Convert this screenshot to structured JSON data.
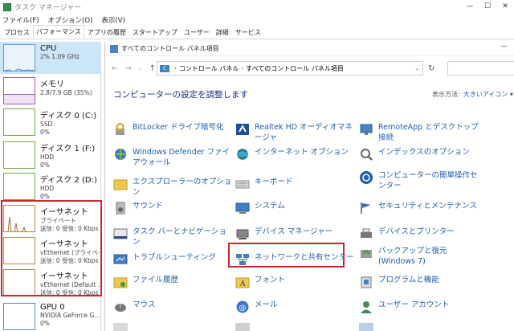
{
  "taskmgr": {
    "title": "タスク マネージャー",
    "menu": [
      "ファイル(F)",
      "オプション(O)",
      "表示(V)"
    ],
    "tabs": [
      "プロセス",
      "パフォーマンス",
      "アプリの履歴",
      "スタートアップ",
      "ユーザー",
      "詳細",
      "サービス"
    ],
    "active_tab": "パフォーマンス",
    "perf_items": [
      {
        "name": "CPU",
        "l2": "2% 1.09 GHz",
        "l3": ""
      },
      {
        "name": "メモリ",
        "l2": "2.8/7.9 GB (35%)",
        "l3": ""
      },
      {
        "name": "ディスク 0 (C:)",
        "l2": "SSD",
        "l3": "0%"
      },
      {
        "name": "ディスク 1 (F:)",
        "l2": "HDD",
        "l3": "0%"
      },
      {
        "name": "ディスク 2 (D:)",
        "l2": "HDD",
        "l3": "0%"
      },
      {
        "name": "イーサネット",
        "l2": "プライベート",
        "l3": "送信: 0 受信: 0 Kbps"
      },
      {
        "name": "イーサネット",
        "l2": "vEthernet (プライベー...",
        "l3": "送信: 0 受信: 0 Kbps"
      },
      {
        "name": "イーサネット",
        "l2": "vEthernet (Default ...",
        "l3": "送信: 0 受信: 0 Kbps"
      },
      {
        "name": "GPU 0",
        "l2": "NVIDIA GeForce G...",
        "l3": "0%"
      }
    ]
  },
  "controlpanel": {
    "window_title": "すべてのコントロール パネル項目",
    "breadcrumb": [
      "コントロール パネル",
      "すべてのコントロール パネル項目"
    ],
    "heading": "コンピューターの設定を調整します",
    "view_label": "表示方法:",
    "view_value": "大きいアイコン ▾",
    "items": [
      {
        "label": "BitLocker ドライブ暗号化",
        "icon": "bitlocker-icon"
      },
      {
        "label": "Realtek HD オーディオマネージャ",
        "icon": "realtek-audio-icon"
      },
      {
        "label": "RemoteApp とデスクトップ接続",
        "icon": "remoteapp-icon"
      },
      {
        "label": "Windows Defender ファイアウォール",
        "icon": "firewall-icon"
      },
      {
        "label": "インターネット オプション",
        "icon": "internet-options-icon"
      },
      {
        "label": "インデックスのオプション",
        "icon": "indexing-icon"
      },
      {
        "label": "エクスプローラーのオプション",
        "icon": "folder-options-icon"
      },
      {
        "label": "キーボード",
        "icon": "keyboard-icon"
      },
      {
        "label": "コンピューターの簡単操作センター",
        "icon": "ease-of-access-icon"
      },
      {
        "label": "サウンド",
        "icon": "sound-icon"
      },
      {
        "label": "システム",
        "icon": "system-icon"
      },
      {
        "label": "セキュリティとメンテナンス",
        "icon": "security-flag-icon"
      },
      {
        "label": "タスク バーとナビゲーション",
        "icon": "taskbar-icon"
      },
      {
        "label": "デバイス マネージャー",
        "icon": "device-manager-icon"
      },
      {
        "label": "デバイスとプリンター",
        "icon": "printer-icon"
      },
      {
        "label": "トラブルシューティング",
        "icon": "troubleshooting-icon"
      },
      {
        "label": "ネットワークと共有センター",
        "icon": "network-sharing-icon"
      },
      {
        "label": "バックアップと復元 (Windows 7)",
        "icon": "backup-icon"
      },
      {
        "label": "ファイル履歴",
        "icon": "file-history-icon"
      },
      {
        "label": "フォント",
        "icon": "fonts-icon"
      },
      {
        "label": "プログラムと機能",
        "icon": "programs-icon"
      },
      {
        "label": "マウス",
        "icon": "mouse-icon"
      },
      {
        "label": "メール",
        "icon": "mail-icon"
      },
      {
        "label": "ユーザー アカウント",
        "icon": "user-accounts-icon"
      }
    ]
  }
}
